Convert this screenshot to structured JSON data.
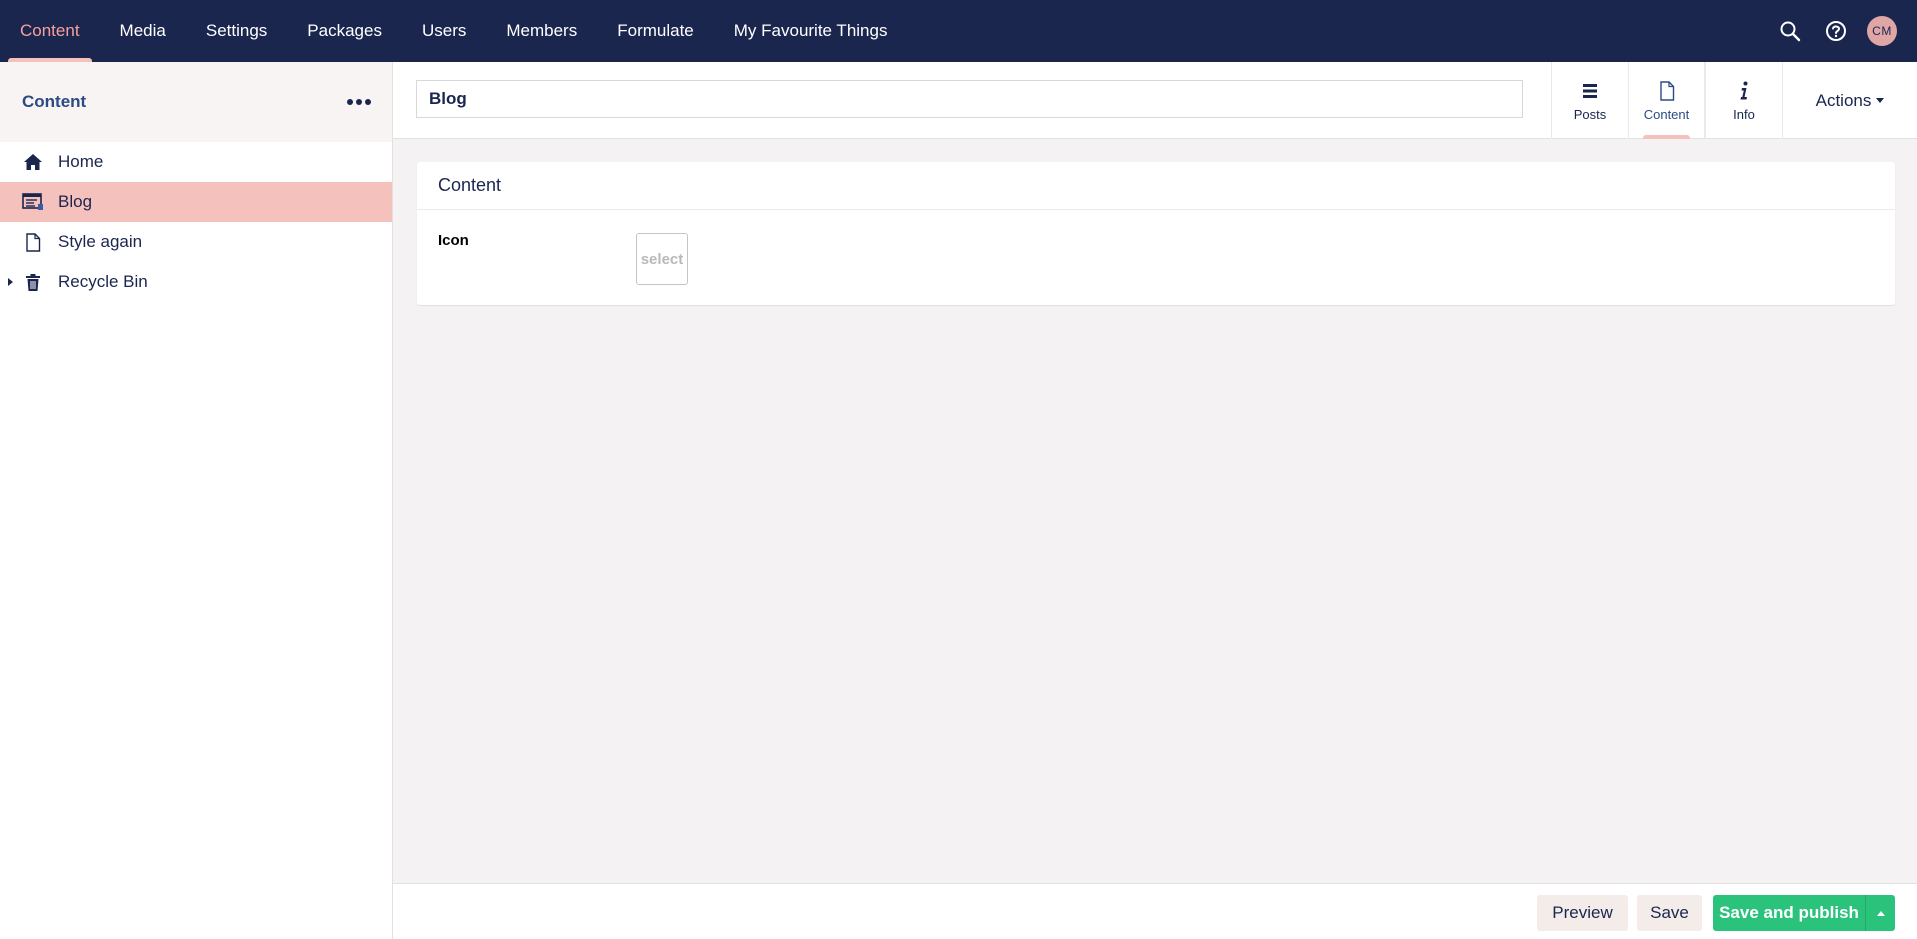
{
  "topnav": {
    "items": [
      {
        "label": "Content",
        "active": true
      },
      {
        "label": "Media"
      },
      {
        "label": "Settings"
      },
      {
        "label": "Packages"
      },
      {
        "label": "Users"
      },
      {
        "label": "Members"
      },
      {
        "label": "Formulate"
      },
      {
        "label": "My Favourite Things"
      }
    ],
    "tools": [
      "search-icon",
      "help-icon"
    ],
    "avatar_initials": "CM"
  },
  "sidebar": {
    "title": "Content",
    "tree": [
      {
        "label": "Home",
        "icon": "home-icon"
      },
      {
        "label": "Blog",
        "icon": "blog-icon",
        "selected": true
      },
      {
        "label": "Style again",
        "icon": "document-icon"
      },
      {
        "label": "Recycle Bin",
        "icon": "trash-icon",
        "expandable": true
      }
    ]
  },
  "editor": {
    "name_value": "Blog",
    "apps": [
      {
        "label": "Posts",
        "icon": "list-icon"
      },
      {
        "label": "Content",
        "icon": "document-icon",
        "active": true
      },
      {
        "label": "Info",
        "icon": "info-icon"
      }
    ],
    "actions_label": "Actions"
  },
  "panel": {
    "title": "Content",
    "property_label": "Icon",
    "select_label": "select"
  },
  "footer": {
    "preview_label": "Preview",
    "save_label": "Save",
    "publish_label": "Save and publish"
  },
  "colors": {
    "topbar": "#1b264f",
    "accent": "#f5c1bc",
    "publish": "#2bc37c"
  }
}
